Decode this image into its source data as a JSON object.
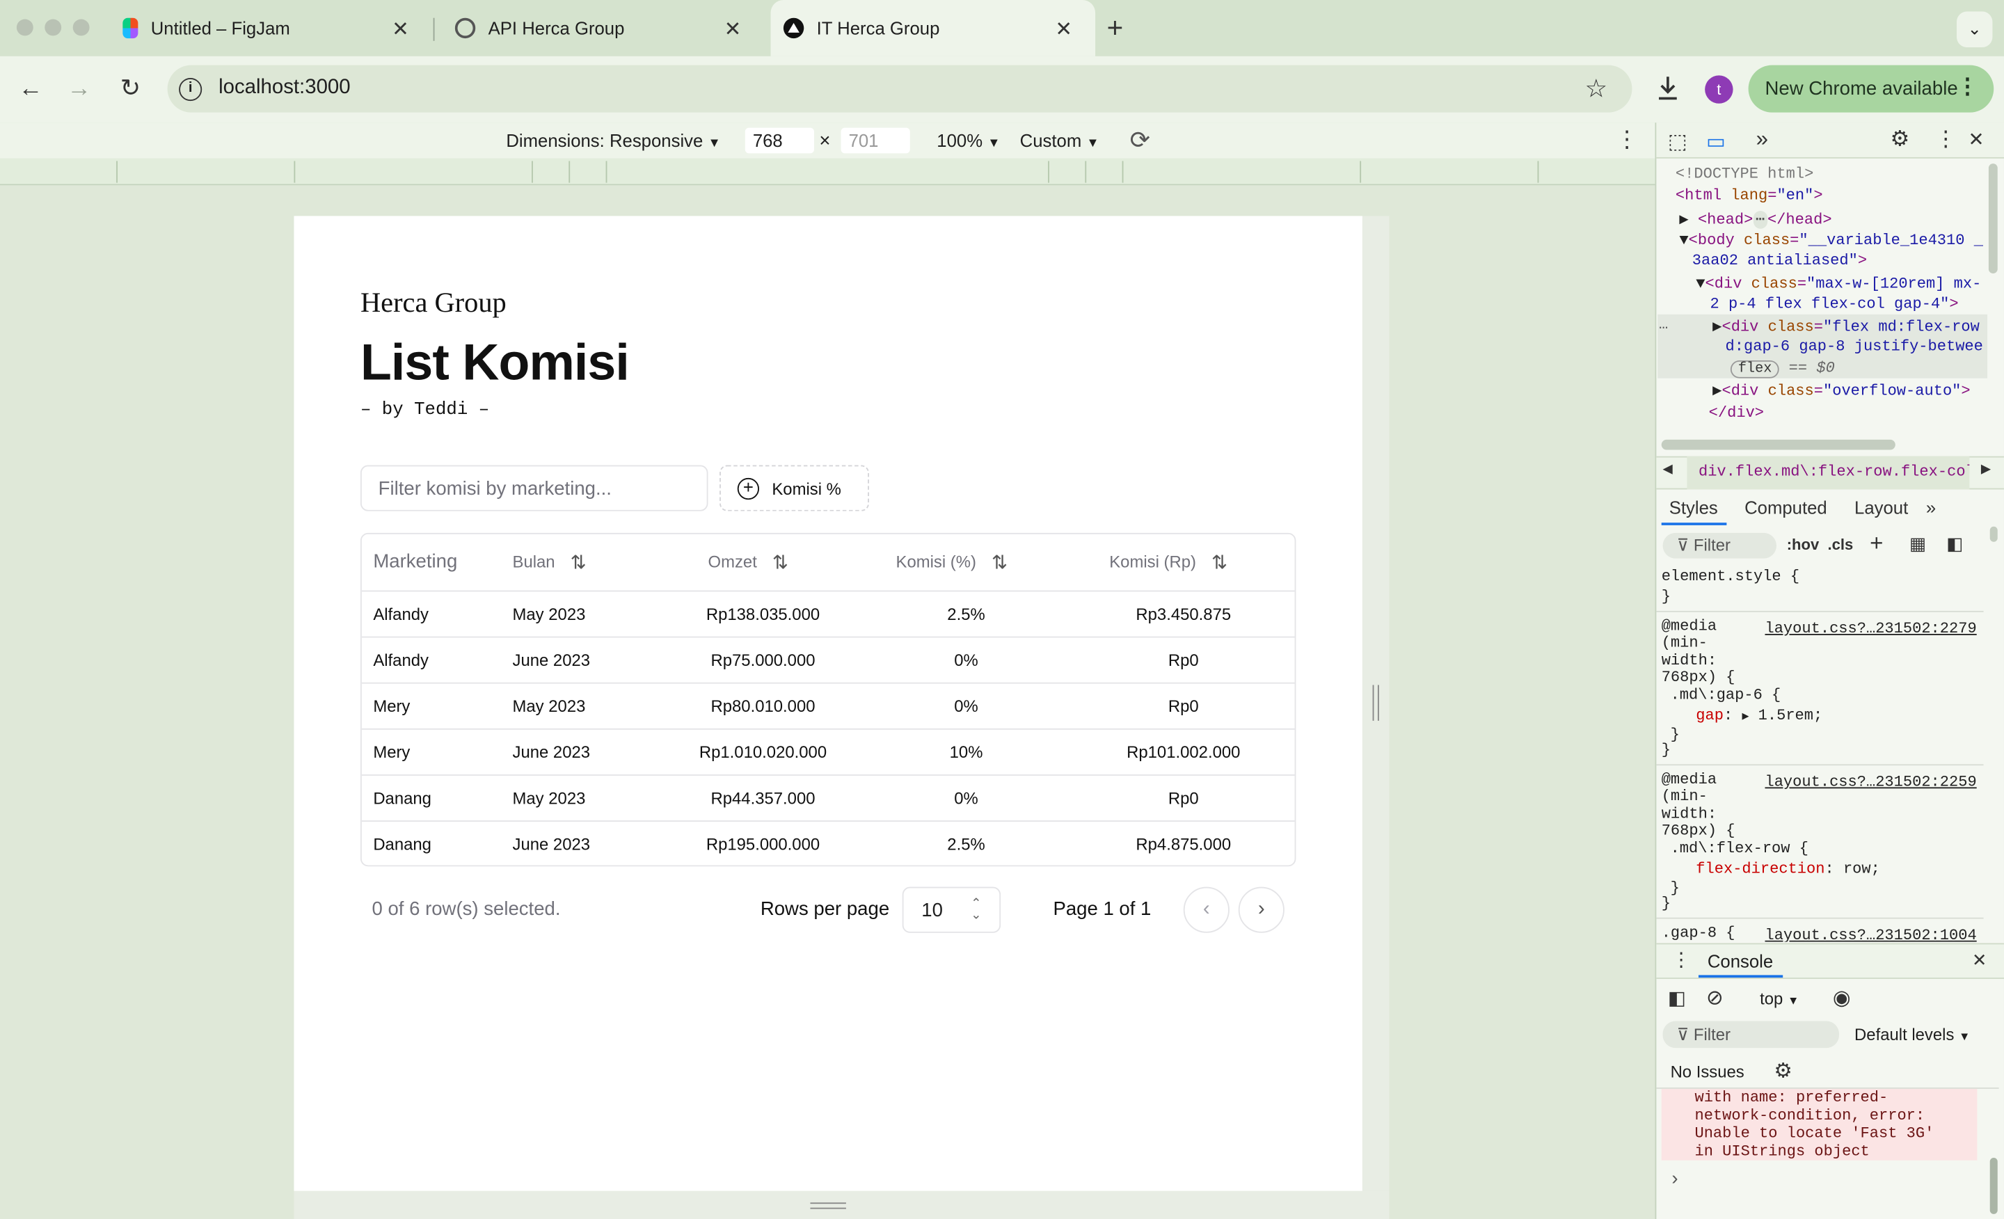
{
  "browser": {
    "tabs": [
      {
        "title": "Untitled – FigJam"
      },
      {
        "title": "API Herca Group"
      },
      {
        "title": "IT Herca Group"
      }
    ],
    "url": "localhost:3000",
    "new_chrome_label": "New Chrome available",
    "profile_initial": "t"
  },
  "device_toolbar": {
    "dimensions_label": "Dimensions: Responsive",
    "width": "768",
    "times": "×",
    "height": "701",
    "zoom": "100%",
    "throttle": "Custom"
  },
  "page": {
    "brand": "Herca Group",
    "title": "List Komisi",
    "byline": "– by Teddi –",
    "filter_placeholder": "Filter komisi by marketing...",
    "komisi_button": "Komisi %",
    "table": {
      "headers": [
        "Marketing",
        "Bulan",
        "Omzet",
        "Komisi (%)",
        "Komisi (Rp)"
      ],
      "rows": [
        [
          "Alfandy",
          "May 2023",
          "Rp138.035.000",
          "2.5%",
          "Rp3.450.875"
        ],
        [
          "Alfandy",
          "June 2023",
          "Rp75.000.000",
          "0%",
          "Rp0"
        ],
        [
          "Mery",
          "May 2023",
          "Rp80.010.000",
          "0%",
          "Rp0"
        ],
        [
          "Mery",
          "June 2023",
          "Rp1.010.020.000",
          "10%",
          "Rp101.002.000"
        ],
        [
          "Danang",
          "May 2023",
          "Rp44.357.000",
          "0%",
          "Rp0"
        ],
        [
          "Danang",
          "June 2023",
          "Rp195.000.000",
          "2.5%",
          "Rp4.875.000"
        ]
      ]
    },
    "selected_text": "0 of 6 row(s) selected.",
    "rows_per_page_label": "Rows per page",
    "rows_per_page_value": "10",
    "page_indicator": "Page 1 of 1"
  },
  "devtools": {
    "dom_lines": {
      "doctype": "<!DOCTYPE html>",
      "html_open": "<html ",
      "html_attr": "lang",
      "html_val": "\"en\"",
      "head_open": "<head>",
      "head_ellipsis": "⋯",
      "head_close": "</head>",
      "body_open": "<body ",
      "body_attr": "class",
      "body_val": "\"__variable_1e4310 _",
      "body_val2": "3aa02 antialiased\"",
      "div1_open": "<div ",
      "div1_attr": "class",
      "div1_val": "\"max-w-[120rem] mx-",
      "div1_val2": "2 p-4 flex flex-col gap-4\"",
      "div2_open": "<div ",
      "div2_attr": "class",
      "div2_val": "\"flex md:flex-row",
      "div2_val2": "d:gap-6 gap-8 justify-betwee",
      "flex_badge": "flex",
      "eq_sign": "== $0",
      "div3_open": "<div ",
      "div3_attr": "class",
      "div3_val": "\"overflow-auto\"",
      "div_close": "</div>"
    },
    "breadcrumb": "div.flex.md\\:flex-row.flex-col.md\\:g",
    "tabs": [
      "Styles",
      "Computed",
      "Layout"
    ],
    "filter_placeholder": "Filter",
    "hov": ":hov",
    "cls": ".cls",
    "styles": {
      "element_style": "element.style {",
      "close_brace": "}",
      "media1_link": "layout.css?…231502:2279",
      "media2_link": "layout.css?…231502:2259",
      "media3_link": "layout.css?…231502:1004",
      "media_kw": "@media",
      "media_cond1": "(min-",
      "media_cond2": "width:",
      "media_cond3": "768px) {",
      "rule1": ".md\\:gap-6 {",
      "rule1_prop": "gap",
      "rule1_val": "1.5rem;",
      "rule2": ".md\\:flex-row {",
      "rule2_prop": "flex-direction",
      "rule2_val": "row;",
      "rule3": ".gap-8 {"
    },
    "console": {
      "title": "Console",
      "context": "top",
      "filter_placeholder": "Filter",
      "levels": "Default levels",
      "issues": "No Issues",
      "error_lines": [
        "with name: preferred-",
        "network-condition, error:",
        "Unable to locate 'Fast 3G'",
        "in UIStrings object"
      ],
      "prompt": "›"
    }
  },
  "colors": {
    "browser_frame": "#d5e3ce",
    "new_chrome_bg": "#a8d5a0",
    "profile_avatar": "#8e3bb5"
  }
}
